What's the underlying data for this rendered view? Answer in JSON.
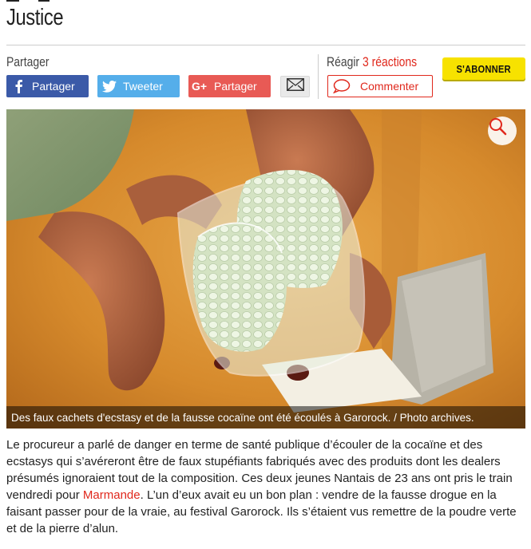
{
  "section": {
    "title": "Justice"
  },
  "share": {
    "label": "Partager",
    "facebook_label": "Partager",
    "twitter_label": "Tweeter",
    "googleplus_label": "Partager"
  },
  "reactions": {
    "label": "Réagir",
    "count_text": "3 réactions",
    "comment_label": "Commenter"
  },
  "subscribe": {
    "label": "S'ABONNER"
  },
  "photo": {
    "caption": "Des faux cachets d'ecstasy et de la fausse cocaïne ont été écoulés à Garorock. / Photo archives."
  },
  "article": {
    "p1_before_link": "Le procureur a parlé de danger en terme de santé publique d’écouler de la cocaïne et des ecstasys qui s’avéreront être de faux stupéfiants fabriqués avec des produits dont les dealers présumés ignoraient tout de la composition. Ces deux jeunes Nantais de 23 ans ont pris le train vendredi pour ",
    "p1_link": "Marmande",
    "p1_after_link": ". L’un d’eux avait eu un bon plan : vendre de la fausse drogue en la faisant passer pour de la vraie, au festival Garorock. Ils s’étaient vus remettre de la poudre verte et de la pierre d’alun."
  },
  "colors": {
    "accent_red": "#e0281c",
    "facebook": "#3b5aa8",
    "twitter": "#55aeea",
    "googleplus": "#e85a55",
    "subscribe_yellow": "#f7e200"
  },
  "icons": [
    "facebook-icon",
    "twitter-icon",
    "googleplus-icon",
    "mail-icon",
    "comment-icon",
    "zoom-icon"
  ]
}
